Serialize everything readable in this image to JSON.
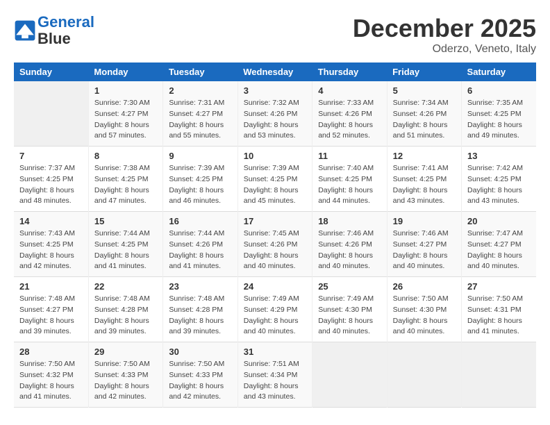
{
  "header": {
    "logo_line1": "General",
    "logo_line2": "Blue",
    "month": "December 2025",
    "location": "Oderzo, Veneto, Italy"
  },
  "weekdays": [
    "Sunday",
    "Monday",
    "Tuesday",
    "Wednesday",
    "Thursday",
    "Friday",
    "Saturday"
  ],
  "rows": [
    [
      {
        "day": "",
        "info": ""
      },
      {
        "day": "1",
        "info": "Sunrise: 7:30 AM\nSunset: 4:27 PM\nDaylight: 8 hours\nand 57 minutes."
      },
      {
        "day": "2",
        "info": "Sunrise: 7:31 AM\nSunset: 4:27 PM\nDaylight: 8 hours\nand 55 minutes."
      },
      {
        "day": "3",
        "info": "Sunrise: 7:32 AM\nSunset: 4:26 PM\nDaylight: 8 hours\nand 53 minutes."
      },
      {
        "day": "4",
        "info": "Sunrise: 7:33 AM\nSunset: 4:26 PM\nDaylight: 8 hours\nand 52 minutes."
      },
      {
        "day": "5",
        "info": "Sunrise: 7:34 AM\nSunset: 4:26 PM\nDaylight: 8 hours\nand 51 minutes."
      },
      {
        "day": "6",
        "info": "Sunrise: 7:35 AM\nSunset: 4:25 PM\nDaylight: 8 hours\nand 49 minutes."
      }
    ],
    [
      {
        "day": "7",
        "info": "Sunrise: 7:37 AM\nSunset: 4:25 PM\nDaylight: 8 hours\nand 48 minutes."
      },
      {
        "day": "8",
        "info": "Sunrise: 7:38 AM\nSunset: 4:25 PM\nDaylight: 8 hours\nand 47 minutes."
      },
      {
        "day": "9",
        "info": "Sunrise: 7:39 AM\nSunset: 4:25 PM\nDaylight: 8 hours\nand 46 minutes."
      },
      {
        "day": "10",
        "info": "Sunrise: 7:39 AM\nSunset: 4:25 PM\nDaylight: 8 hours\nand 45 minutes."
      },
      {
        "day": "11",
        "info": "Sunrise: 7:40 AM\nSunset: 4:25 PM\nDaylight: 8 hours\nand 44 minutes."
      },
      {
        "day": "12",
        "info": "Sunrise: 7:41 AM\nSunset: 4:25 PM\nDaylight: 8 hours\nand 43 minutes."
      },
      {
        "day": "13",
        "info": "Sunrise: 7:42 AM\nSunset: 4:25 PM\nDaylight: 8 hours\nand 43 minutes."
      }
    ],
    [
      {
        "day": "14",
        "info": "Sunrise: 7:43 AM\nSunset: 4:25 PM\nDaylight: 8 hours\nand 42 minutes."
      },
      {
        "day": "15",
        "info": "Sunrise: 7:44 AM\nSunset: 4:25 PM\nDaylight: 8 hours\nand 41 minutes."
      },
      {
        "day": "16",
        "info": "Sunrise: 7:44 AM\nSunset: 4:26 PM\nDaylight: 8 hours\nand 41 minutes."
      },
      {
        "day": "17",
        "info": "Sunrise: 7:45 AM\nSunset: 4:26 PM\nDaylight: 8 hours\nand 40 minutes."
      },
      {
        "day": "18",
        "info": "Sunrise: 7:46 AM\nSunset: 4:26 PM\nDaylight: 8 hours\nand 40 minutes."
      },
      {
        "day": "19",
        "info": "Sunrise: 7:46 AM\nSunset: 4:27 PM\nDaylight: 8 hours\nand 40 minutes."
      },
      {
        "day": "20",
        "info": "Sunrise: 7:47 AM\nSunset: 4:27 PM\nDaylight: 8 hours\nand 40 minutes."
      }
    ],
    [
      {
        "day": "21",
        "info": "Sunrise: 7:48 AM\nSunset: 4:27 PM\nDaylight: 8 hours\nand 39 minutes."
      },
      {
        "day": "22",
        "info": "Sunrise: 7:48 AM\nSunset: 4:28 PM\nDaylight: 8 hours\nand 39 minutes."
      },
      {
        "day": "23",
        "info": "Sunrise: 7:48 AM\nSunset: 4:28 PM\nDaylight: 8 hours\nand 39 minutes."
      },
      {
        "day": "24",
        "info": "Sunrise: 7:49 AM\nSunset: 4:29 PM\nDaylight: 8 hours\nand 40 minutes."
      },
      {
        "day": "25",
        "info": "Sunrise: 7:49 AM\nSunset: 4:30 PM\nDaylight: 8 hours\nand 40 minutes."
      },
      {
        "day": "26",
        "info": "Sunrise: 7:50 AM\nSunset: 4:30 PM\nDaylight: 8 hours\nand 40 minutes."
      },
      {
        "day": "27",
        "info": "Sunrise: 7:50 AM\nSunset: 4:31 PM\nDaylight: 8 hours\nand 41 minutes."
      }
    ],
    [
      {
        "day": "28",
        "info": "Sunrise: 7:50 AM\nSunset: 4:32 PM\nDaylight: 8 hours\nand 41 minutes."
      },
      {
        "day": "29",
        "info": "Sunrise: 7:50 AM\nSunset: 4:33 PM\nDaylight: 8 hours\nand 42 minutes."
      },
      {
        "day": "30",
        "info": "Sunrise: 7:50 AM\nSunset: 4:33 PM\nDaylight: 8 hours\nand 42 minutes."
      },
      {
        "day": "31",
        "info": "Sunrise: 7:51 AM\nSunset: 4:34 PM\nDaylight: 8 hours\nand 43 minutes."
      },
      {
        "day": "",
        "info": ""
      },
      {
        "day": "",
        "info": ""
      },
      {
        "day": "",
        "info": ""
      }
    ]
  ]
}
